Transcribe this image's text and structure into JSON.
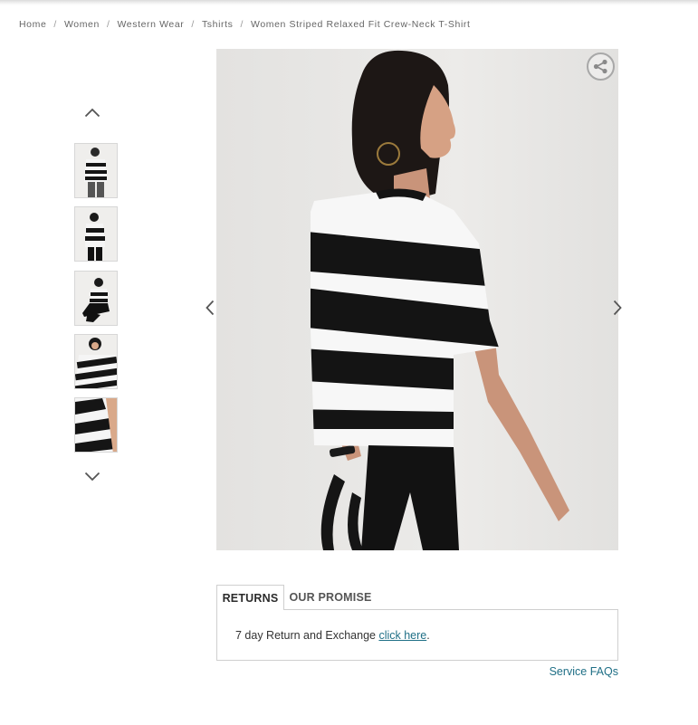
{
  "breadcrumb": {
    "items": [
      "Home",
      "Women",
      "Western Wear",
      "Tshirts",
      "Women Striped Relaxed Fit Crew-Neck T-Shirt"
    ],
    "separator": "/"
  },
  "gallery": {
    "up_icon": "chevron-up-icon",
    "down_icon": "chevron-down-icon",
    "thumbnails": [
      "thumbnail-1",
      "thumbnail-2",
      "thumbnail-3",
      "thumbnail-4",
      "thumbnail-5"
    ],
    "prev_icon": "chevron-left-icon",
    "next_icon": "chevron-right-icon",
    "share_icon": "share-icon"
  },
  "tabs": {
    "items": [
      "RETURNS",
      "OUR PROMISE"
    ],
    "active": "RETURNS",
    "panel_text": "7 day Return and Exchange ",
    "panel_link": "click here",
    "panel_suffix": "."
  },
  "footer": {
    "faq_link": "Service FAQs"
  },
  "colors": {
    "link": "#1f6f86",
    "border": "#cfcfcf",
    "stripe_black": "#141414",
    "stripe_white": "#f7f7f7"
  }
}
